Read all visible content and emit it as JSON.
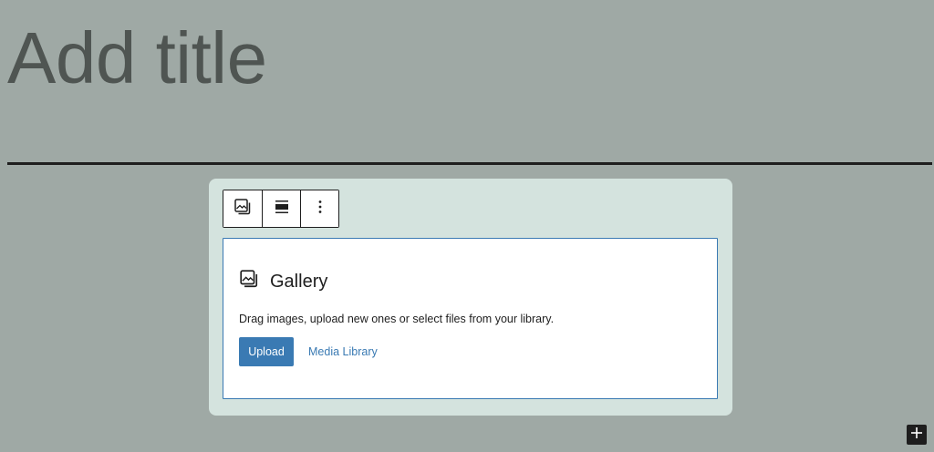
{
  "editor": {
    "title_placeholder": "Add title"
  },
  "toolbar": {
    "items": [
      {
        "name": "block-type",
        "icon": "gallery-icon"
      },
      {
        "name": "align",
        "icon": "align-wide-icon"
      },
      {
        "name": "more-options",
        "icon": "more-vertical-icon"
      }
    ]
  },
  "gallery": {
    "icon": "gallery-icon",
    "title": "Gallery",
    "instructions": "Drag images, upload new ones or select files from your library.",
    "upload_label": "Upload",
    "media_library_label": "Media Library"
  },
  "inserter": {
    "icon": "plus-icon"
  },
  "colors": {
    "background": "#9fa9a5",
    "block_highlight": "#d4e3de",
    "accent": "#3a7ab3",
    "text": "#1e1e1e"
  }
}
